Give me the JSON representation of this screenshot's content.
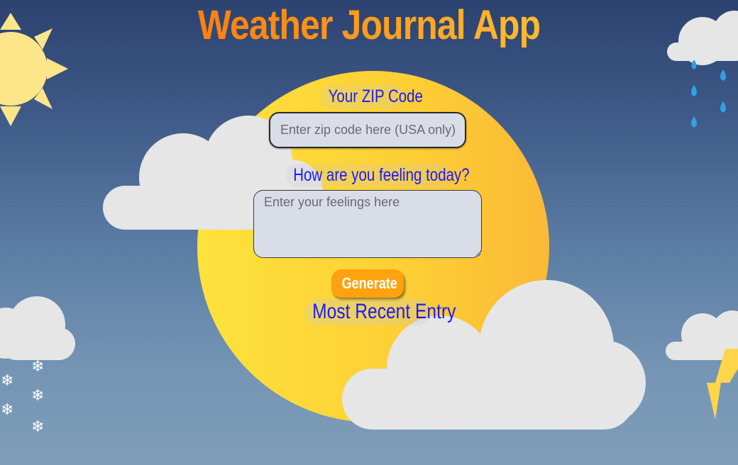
{
  "app": {
    "title": "Weather Journal App"
  },
  "form": {
    "zip_label": "Your ZIP Code",
    "zip_placeholder": "Enter zip code here (USA only)",
    "zip_value": "",
    "feelings_label": "How are you feeling today?",
    "feelings_placeholder": "Enter your feelings here",
    "feelings_value": "",
    "generate_label": "Generate"
  },
  "entry": {
    "heading": "Most Recent Entry"
  },
  "decor": {
    "snowflake_glyph": "❄",
    "sun_color": "#fde58a",
    "moon_color": "#fdd835",
    "cloud_color": "#e6e6e6",
    "rain_color": "#2ea3e6",
    "bolt_color": "#ffd54a"
  }
}
